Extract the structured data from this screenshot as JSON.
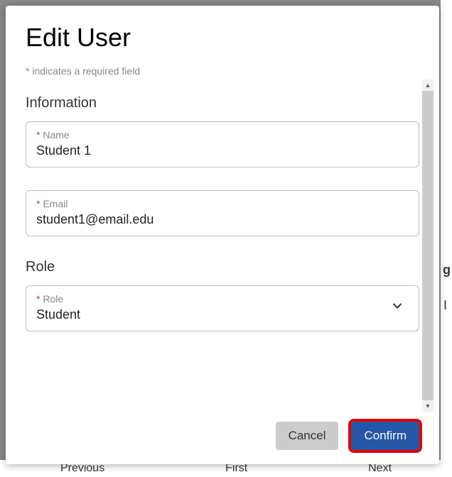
{
  "modal": {
    "title": "Edit User",
    "required_note": "* indicates a required field"
  },
  "sections": {
    "information": {
      "title": "Information",
      "name": {
        "label": "Name",
        "value": "Student 1"
      },
      "email": {
        "label": "Email",
        "value": "student1@email.edu"
      }
    },
    "role": {
      "title": "Role",
      "field": {
        "label": "Role",
        "value": "Student"
      }
    }
  },
  "footer": {
    "cancel": "Cancel",
    "confirm": "Confirm"
  },
  "required_marker": "* ",
  "background": {
    "previous": "Previous",
    "first": "First",
    "next": "Next",
    "g": "g",
    "bar": "I"
  }
}
